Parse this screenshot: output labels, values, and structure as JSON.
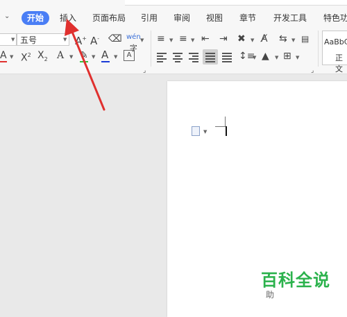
{
  "tabs": [
    {
      "label": "开始",
      "active": true
    },
    {
      "label": "插入",
      "active": false
    },
    {
      "label": "页面布局",
      "active": false
    },
    {
      "label": "引用",
      "active": false
    },
    {
      "label": "审阅",
      "active": false
    },
    {
      "label": "视图",
      "active": false
    },
    {
      "label": "章节",
      "active": false
    },
    {
      "label": "开发工具",
      "active": false
    },
    {
      "label": "特色功",
      "active": false
    }
  ],
  "font": {
    "size_value": "五号"
  },
  "styles": {
    "preview": "AaBbC",
    "normal_label": "正文"
  },
  "watermark": {
    "text": "百科全说",
    "sub": "助"
  },
  "accent_colors": {
    "tab_active": "#4a7ef5",
    "arrow": "#e0302e",
    "highlight": "#3bbf3b",
    "font_color": "#1a3bd6",
    "font_red_underline": "#e0302e"
  }
}
